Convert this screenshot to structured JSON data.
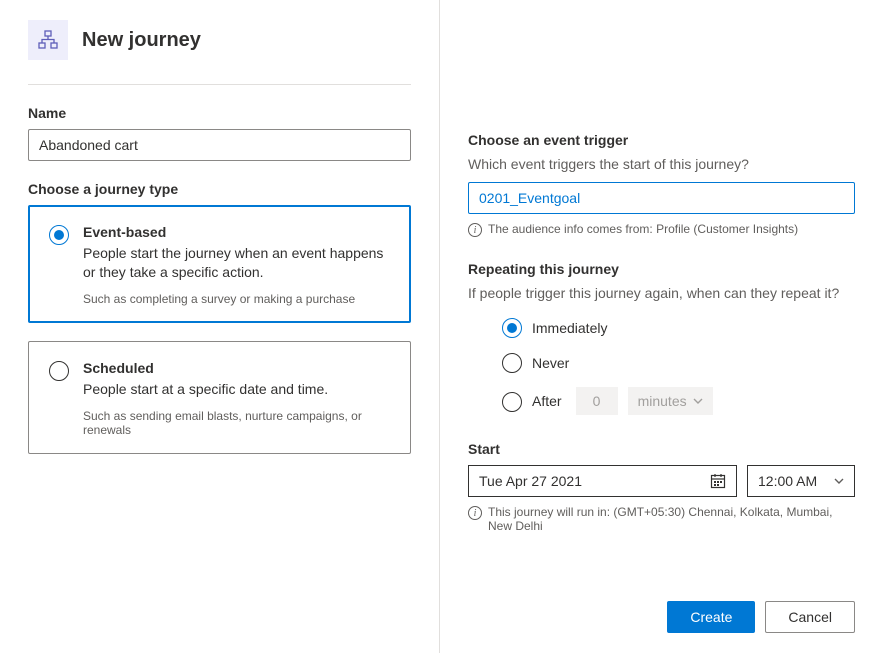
{
  "header": {
    "title": "New journey"
  },
  "left": {
    "name_label": "Name",
    "name_value": "Abandoned cart",
    "journey_type_label": "Choose a journey type",
    "event_based": {
      "title": "Event-based",
      "desc": "People start the journey when an event happens or they take a specific action.",
      "hint": "Such as completing a survey or making a purchase"
    },
    "scheduled": {
      "title": "Scheduled",
      "desc": "People start at a specific date and time.",
      "hint": "Such as sending email blasts, nurture campaigns, or renewals"
    }
  },
  "right": {
    "trigger_label": "Choose an event trigger",
    "trigger_subtext": "Which event triggers the start of this journey?",
    "trigger_value": "0201_Eventgoal",
    "audience_info": "The audience info comes from: Profile (Customer Insights)",
    "repeat_label": "Repeating this journey",
    "repeat_subtext": "If people trigger this journey again, when can they repeat it?",
    "repeat_options": {
      "immediately": "Immediately",
      "never": "Never",
      "after": "After",
      "after_value": "0",
      "after_unit": "minutes"
    },
    "start_label": "Start",
    "start_date": "Tue Apr 27 2021",
    "start_time": "12:00 AM",
    "timezone_info": "This journey will run in: (GMT+05:30) Chennai, Kolkata, Mumbai, New Delhi"
  },
  "footer": {
    "create": "Create",
    "cancel": "Cancel"
  }
}
